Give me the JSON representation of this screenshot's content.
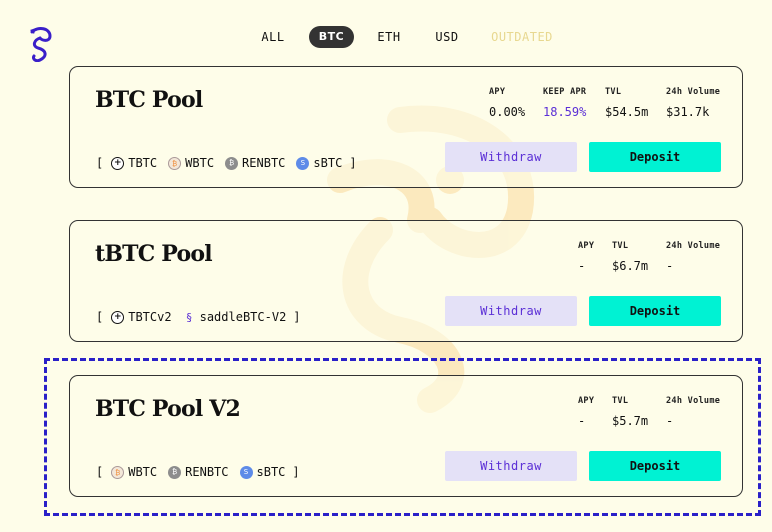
{
  "brand": {
    "logo_icon": "saddle-seahorse-icon",
    "accent": "#2a20c8"
  },
  "tabs": [
    {
      "label": "ALL",
      "active": false
    },
    {
      "label": "BTC",
      "active": true
    },
    {
      "label": "ETH",
      "active": false
    },
    {
      "label": "USD",
      "active": false
    },
    {
      "label": "OUTDATED",
      "active": false
    }
  ],
  "pools": [
    {
      "title": "BTC Pool",
      "stats": [
        {
          "label": "APY",
          "value": "0.00%"
        },
        {
          "label": "KEEP APR",
          "value": "18.59%"
        },
        {
          "label": "TVL",
          "value": "$54.5m"
        },
        {
          "label": "24h Volume",
          "value": "$31.7k"
        }
      ],
      "bracket_open": "[",
      "bracket_close": "]",
      "tokens": [
        {
          "name": "TBTC",
          "icon": "tbtc-icon"
        },
        {
          "name": "WBTC",
          "icon": "wbtc-icon"
        },
        {
          "name": "RENBTC",
          "icon": "renbtc-icon"
        },
        {
          "name": "sBTC",
          "icon": "sbtc-icon"
        }
      ],
      "withdraw_label": "Withdraw",
      "deposit_label": "Deposit"
    },
    {
      "title": "tBTC Pool",
      "stats": [
        {
          "label": "APY",
          "value": "-"
        },
        {
          "label": "TVL",
          "value": "$6.7m"
        },
        {
          "label": "24h Volume",
          "value": "-"
        }
      ],
      "bracket_open": "[",
      "bracket_close": "]",
      "tokens": [
        {
          "name": "TBTCv2",
          "icon": "tbtc-icon"
        },
        {
          "name": "saddleBTC-V2",
          "icon": "saddle-icon"
        }
      ],
      "withdraw_label": "Withdraw",
      "deposit_label": "Deposit"
    },
    {
      "title": "BTC Pool V2",
      "stats": [
        {
          "label": "APY",
          "value": "-"
        },
        {
          "label": "TVL",
          "value": "$5.7m"
        },
        {
          "label": "24h Volume",
          "value": "-"
        }
      ],
      "bracket_open": "[",
      "bracket_close": "]",
      "tokens": [
        {
          "name": "WBTC",
          "icon": "wbtc-icon"
        },
        {
          "name": "RENBTC",
          "icon": "renbtc-icon"
        },
        {
          "name": "sBTC",
          "icon": "sbtc-icon"
        }
      ],
      "withdraw_label": "Withdraw",
      "deposit_label": "Deposit"
    }
  ]
}
